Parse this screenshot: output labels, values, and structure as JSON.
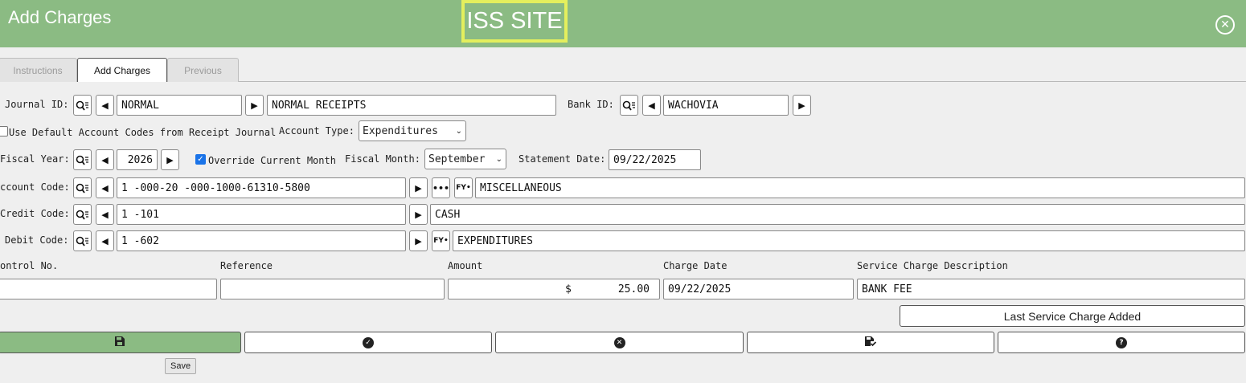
{
  "window": {
    "title": "Add Charges",
    "site": "ISS SITE"
  },
  "tabs": [
    "Instructions",
    "Add Charges",
    "Previous"
  ],
  "journal": {
    "label": "Journal ID:",
    "id": "NORMAL",
    "description": "NORMAL RECEIPTS"
  },
  "bank": {
    "label": "Bank ID:",
    "id": "WACHOVIA"
  },
  "default_codes": {
    "label": "Use Default Account Codes from Receipt Journal",
    "checked": false
  },
  "account_type": {
    "label": "Account Type:",
    "value": "Expenditures"
  },
  "fiscal_year": {
    "label": "Fiscal Year:",
    "value": "2026"
  },
  "override_month": {
    "label": "Override Current Month",
    "checked": true
  },
  "fiscal_month": {
    "label": "Fiscal Month:",
    "value": "September"
  },
  "statement_date": {
    "label": "Statement Date:",
    "value": "09/22/2025"
  },
  "account_code": {
    "label": "ccount Code:",
    "value": "1 -000-20 -000-1000-61310-5800",
    "description": "MISCELLANEOUS"
  },
  "credit_code": {
    "label": "Credit Code:",
    "value": "1 -101",
    "description": "CASH"
  },
  "debit_code": {
    "label": "Debit Code:",
    "value": "1 -602",
    "description": "EXPENDITURES"
  },
  "columns": {
    "control": "ontrol No.",
    "reference": "Reference",
    "amount": "Amount",
    "charge_date": "Charge Date",
    "description": "Service Charge Description"
  },
  "entry": {
    "control": "",
    "reference": "",
    "currency": "$",
    "amount": "25.00",
    "charge_date": "09/22/2025",
    "description": "BANK FEE"
  },
  "last_charge_button": "Last Service Charge Added",
  "tooltip": "Save",
  "icons": {
    "lookup": "search-list-icon",
    "prev": "triangle-left-icon",
    "next": "triangle-right-icon",
    "more": "ellipsis-icon",
    "fy": "fy-icon",
    "close": "close-circle-icon",
    "save": "floppy-icon",
    "confirm": "check-circle-icon",
    "cancel": "x-circle-icon",
    "save_check": "floppy-check-icon",
    "help": "question-circle-icon"
  },
  "colors": {
    "header": "#8bbb83",
    "site_border": "#e4ef5d"
  }
}
